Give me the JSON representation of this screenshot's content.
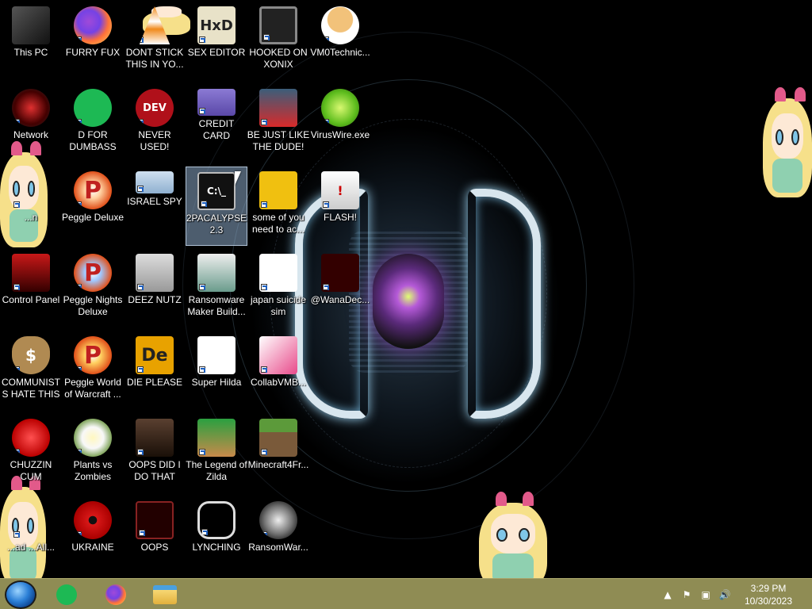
{
  "desktop": {
    "icons": [
      {
        "label": "This PC",
        "icon": "this-pc-icon"
      },
      {
        "label": "FURRY FUX",
        "icon": "firefox-icon"
      },
      {
        "label": "DONT STICK THIS IN YO...",
        "icon": "vlc-cone-icon"
      },
      {
        "label": "SEX EDITOR",
        "icon": "hxd-icon"
      },
      {
        "label": "HOOKED ON XONIX",
        "icon": "xonix-icon"
      },
      {
        "label": "VM0Technic...",
        "icon": "technician-icon"
      },
      {
        "label": "Network",
        "icon": "network-icon"
      },
      {
        "label": "D FOR DUMBASS",
        "icon": "spotify-icon"
      },
      {
        "label": "NEVER USED!",
        "icon": "devcpp-icon"
      },
      {
        "label": "CREDIT CARD CHECKER",
        "icon": "credit-card-icon"
      },
      {
        "label": "BE JUST LIKE THE DUDE!",
        "icon": "santa-icon"
      },
      {
        "label": "VirusWire.exe",
        "icon": "limewire-icon"
      },
      {
        "label": "...n",
        "icon": "star-character-icon"
      },
      {
        "label": "Peggle Deluxe",
        "icon": "peggle-icon"
      },
      {
        "label": "ISRAEL SPY",
        "icon": "spy-computer-icon"
      },
      {
        "label": "2PACALYPSE 2.3",
        "icon": "console-icon"
      },
      {
        "label": "some of you need to ac...",
        "icon": "dog-icon"
      },
      {
        "label": "FLASH!",
        "icon": "flash-icon"
      },
      {
        "label": "Control Panel",
        "icon": "control-panel-icon"
      },
      {
        "label": "Peggle Nights Deluxe",
        "icon": "peggle-nights-icon"
      },
      {
        "label": "DEEZ NUTZ",
        "icon": "stacked-windows-icon"
      },
      {
        "label": "Ransomware Maker Build...",
        "icon": "ransomware-maker-icon"
      },
      {
        "label": "japan suicide sim",
        "icon": "japan-sim-icon"
      },
      {
        "label": "@WanaDec...",
        "icon": "wanadecrypt-icon"
      },
      {
        "label": "COMMUNISTS HATE THIS G...",
        "icon": "money-bag-icon"
      },
      {
        "label": "Peggle World of Warcraft ...",
        "icon": "peggle-wow-icon"
      },
      {
        "label": "DIE PLEASE",
        "icon": "de-icon"
      },
      {
        "label": "Super Hilda",
        "icon": "hilda-icon"
      },
      {
        "label": "CollabVMB...",
        "icon": "collabvm-icon"
      },
      {
        "label": "CHUZZIN CUM",
        "icon": "chuzzle-icon"
      },
      {
        "label": "Plants vs Zombies",
        "icon": "pvz-icon"
      },
      {
        "label": "OOPS DID I DO THAT",
        "icon": "portrait-icon"
      },
      {
        "label": "The Legend of Zilda",
        "icon": "zelda-icon"
      },
      {
        "label": "Minecraft4Fr...",
        "icon": "minecraft-icon"
      },
      {
        "label": "...ad ...All...",
        "icon": "star-character-icon"
      },
      {
        "label": "UKRAINE",
        "icon": "radiation-icon"
      },
      {
        "label": "OOPS",
        "icon": "oops-icon"
      },
      {
        "label": "LYNCHING",
        "icon": "lynching-icon"
      },
      {
        "label": "RansomWar...",
        "icon": "ransomware-icon"
      }
    ]
  },
  "taskbar": {
    "pinned": [
      {
        "icon": "spotify-icon",
        "color": "#1db954"
      },
      {
        "icon": "firefox-icon",
        "color": "#ff7139"
      },
      {
        "icon": "file-explorer-icon",
        "color": "#f0c040"
      }
    ],
    "tray": {
      "time": "3:29 PM",
      "date": "10/30/2023",
      "icons": [
        "show-hidden-icon",
        "flag-icon",
        "network-tray-icon",
        "volume-icon"
      ]
    }
  },
  "colors": {
    "taskbar": "#8f8c54",
    "selection": "#8caac8"
  }
}
